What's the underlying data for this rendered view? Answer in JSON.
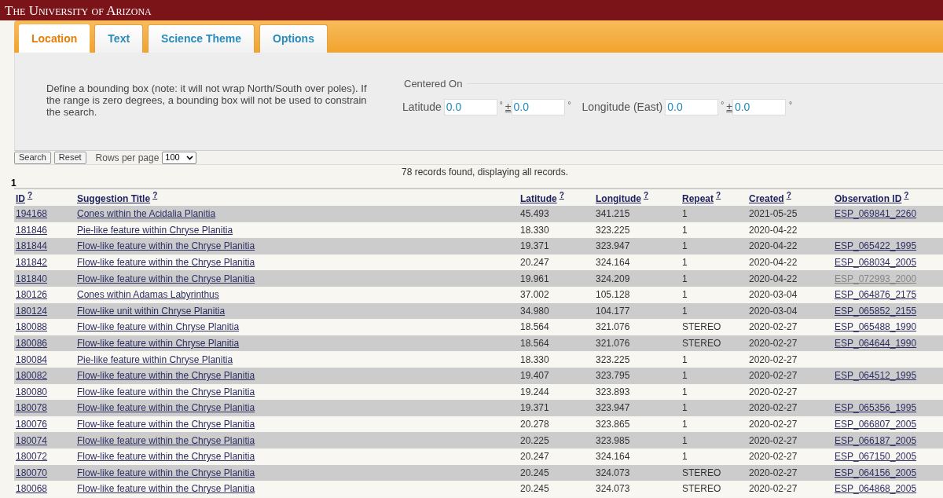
{
  "header": {
    "title": "The University of Arizona"
  },
  "tabs": [
    {
      "label": "Location",
      "selected": true
    },
    {
      "label": "Text",
      "selected": false
    },
    {
      "label": "Science Theme",
      "selected": false
    },
    {
      "label": "Options",
      "selected": false
    }
  ],
  "panel": {
    "description": "Define a bounding box (note: it will not wrap North/South over poles). If the range is zero degrees, a bounding box will not be used to constrain the search.",
    "fieldset_legend": "Centered On",
    "fields": [
      {
        "label": "Latitude",
        "value": "0.0",
        "plus_minus": "±",
        "range": "0.0",
        "unit": "°",
        "range_unit": "°"
      },
      {
        "label": "Longitude (East)",
        "value": "0.0",
        "plus_minus": "±",
        "range": "0.0",
        "unit": "°",
        "range_unit": "°"
      }
    ]
  },
  "toolbar": {
    "buttons": [
      "Search",
      "Reset"
    ],
    "rows_label": "Rows per page",
    "rows_value": "100"
  },
  "summary": "78 records found, displaying all records.",
  "page": "1",
  "table": {
    "columns": [
      {
        "label": "ID",
        "help": "?"
      },
      {
        "label": "Suggestion Title",
        "help": "?"
      },
      {
        "label": "Latitude",
        "help": "?"
      },
      {
        "label": "Longitude",
        "help": "?"
      },
      {
        "label": "Repeat",
        "help": "?"
      },
      {
        "label": "Created",
        "help": "?"
      },
      {
        "label": "Observation ID",
        "help": "?"
      }
    ],
    "rows": [
      {
        "id": "194168",
        "title": "Cones within the Acidalia Planitia",
        "latitude": "45.493",
        "longitude": "341.215",
        "repeat": "1",
        "created": "2021-05-25",
        "observation": "ESP_069841_2260",
        "visited": false
      },
      {
        "id": "181846",
        "title": "Pie-like feature within Chryse Planitia",
        "latitude": "18.330",
        "longitude": "323.225",
        "repeat": "1",
        "created": "2020-04-22"
      },
      {
        "id": "181844",
        "title": "Flow-like feature within the Chryse Planitia",
        "latitude": "19.371",
        "longitude": "323.947",
        "repeat": "1",
        "created": "2020-04-22",
        "observation": "ESP_065422_1995",
        "visited": false
      },
      {
        "id": "181842",
        "title": "Flow-like feature within the Chryse Planitia",
        "latitude": "20.247",
        "longitude": "324.164",
        "repeat": "1",
        "created": "2020-04-22",
        "observation": "ESP_068034_2005",
        "visited": false
      },
      {
        "id": "181840",
        "title": "Flow-like feature within the Chryse Planitia",
        "latitude": "19.961",
        "longitude": "324.209",
        "repeat": "1",
        "created": "2020-04-22",
        "observation": "ESP_072993_2000",
        "visited": true
      },
      {
        "id": "180126",
        "title": "Cones within Adamas Labyrinthus",
        "latitude": "37.002",
        "longitude": "105.128",
        "repeat": "1",
        "created": "2020-03-04",
        "observation": "ESP_064876_2175",
        "visited": false
      },
      {
        "id": "180124",
        "title": "Flow-like unit within Chryse Planitia",
        "latitude": "34.980",
        "longitude": "104.177",
        "repeat": "1",
        "created": "2020-03-04",
        "observation": "ESP_065852_2155",
        "visited": false
      },
      {
        "id": "180088",
        "title": "Flow-like feature within Chryse Planitia",
        "latitude": "18.564",
        "longitude": "321.076",
        "repeat": "STEREO",
        "created": "2020-02-27",
        "observation": "ESP_065488_1990",
        "visited": false
      },
      {
        "id": "180086",
        "title": "Flow-like feature within Chryse Planitia",
        "latitude": "18.564",
        "longitude": "321.076",
        "repeat": "STEREO",
        "created": "2020-02-27",
        "observation": "ESP_064644_1990",
        "visited": false
      },
      {
        "id": "180084",
        "title": "Pie-like feature within Chryse Planitia",
        "latitude": "18.330",
        "longitude": "323.225",
        "repeat": "1",
        "created": "2020-02-27"
      },
      {
        "id": "180082",
        "title": "Flow-like feature within the Chryse Planitia",
        "latitude": "19.407",
        "longitude": "323.795",
        "repeat": "1",
        "created": "2020-02-27",
        "observation": "ESP_064512_1995",
        "visited": false
      },
      {
        "id": "180080",
        "title": "Flow-like feature within the Chryse Planitia",
        "latitude": "19.244",
        "longitude": "323.893",
        "repeat": "1",
        "created": "2020-02-27"
      },
      {
        "id": "180078",
        "title": "Flow-like feature within the Chryse Planitia",
        "latitude": "19.371",
        "longitude": "323.947",
        "repeat": "1",
        "created": "2020-02-27",
        "observation": "ESP_065356_1995",
        "visited": false
      },
      {
        "id": "180076",
        "title": "Flow-like feature within the Chryse Planitia",
        "latitude": "20.278",
        "longitude": "323.865",
        "repeat": "1",
        "created": "2020-02-27",
        "observation": "ESP_066807_2005",
        "visited": false
      },
      {
        "id": "180074",
        "title": "Flow-like feature within the Chryse Planitia",
        "latitude": "20.225",
        "longitude": "323.985",
        "repeat": "1",
        "created": "2020-02-27",
        "observation": "ESP_066187_2005",
        "visited": false
      },
      {
        "id": "180072",
        "title": "Flow-like feature within the Chryse Planitia",
        "latitude": "20.247",
        "longitude": "324.164",
        "repeat": "1",
        "created": "2020-02-27",
        "observation": "ESP_067150_2005",
        "visited": false
      },
      {
        "id": "180070",
        "title": "Flow-like feature within the Chryse Planitia",
        "latitude": "20.245",
        "longitude": "324.073",
        "repeat": "STEREO",
        "created": "2020-02-27",
        "observation": "ESP_064156_2005",
        "visited": false
      },
      {
        "id": "180068",
        "title": "Flow-like feature within the Chryse Planitia",
        "latitude": "20.245",
        "longitude": "324.073",
        "repeat": "STEREO",
        "created": "2020-02-27",
        "observation": "ESP_064868_2005",
        "visited": false
      }
    ]
  }
}
